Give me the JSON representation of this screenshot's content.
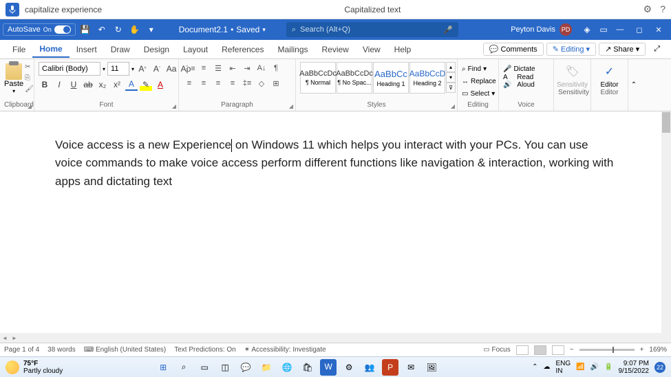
{
  "voice": {
    "status": "capitalize experience",
    "result": "Capitalized text",
    "settings_icon": "⚙",
    "help_icon": "?"
  },
  "titlebar": {
    "autosave_label": "AutoSave",
    "autosave_state": "On",
    "doc_name": "Document2.1",
    "doc_state": "Saved",
    "search_placeholder": "Search (Alt+Q)",
    "user_name": "Peyton Davis",
    "user_initials": "PD"
  },
  "tabs": [
    "File",
    "Home",
    "Insert",
    "Draw",
    "Design",
    "Layout",
    "References",
    "Mailings",
    "Review",
    "View",
    "Help"
  ],
  "active_tab": "Home",
  "tab_actions": {
    "comments": "Comments",
    "editing": "Editing",
    "share": "Share"
  },
  "ribbon": {
    "clipboard": {
      "label": "Clipboard",
      "paste": "Paste"
    },
    "font": {
      "label": "Font",
      "family": "Calibri (Body)",
      "size": "11",
      "buttons": {
        "bold": "B",
        "italic": "I",
        "underline": "U",
        "strike": "ab",
        "sub": "x₂",
        "sup": "x²",
        "effects": "A",
        "highlight": "✎",
        "color": "A"
      },
      "grow": "A",
      "shrink": "A",
      "case": "Aa",
      "clear": "Aρ"
    },
    "paragraph": {
      "label": "Paragraph"
    },
    "styles": {
      "label": "Styles",
      "items": [
        {
          "preview": "AaBbCcDc",
          "name": "¶ Normal"
        },
        {
          "preview": "AaBbCcDc",
          "name": "¶ No Spac..."
        },
        {
          "preview": "AaBbCc",
          "name": "Heading 1"
        },
        {
          "preview": "AaBbCcD",
          "name": "Heading 2"
        }
      ]
    },
    "editing": {
      "label": "Editing",
      "find": "Find",
      "replace": "Replace",
      "select": "Select"
    },
    "voice": {
      "label": "Voice",
      "dictate": "Dictate",
      "read": "Read Aloud"
    },
    "sensitivity": {
      "label": "Sensitivity",
      "btn": "Sensitivity"
    },
    "editor": {
      "label": "Editor",
      "btn": "Editor"
    }
  },
  "document": {
    "text_before": "Voice access is a new Experience",
    "text_after": " on Windows 11 which helps you interact with your PCs. You can use voice commands to make voice access perform different functions like navigation & interaction, working with apps and dictating text"
  },
  "statusbar": {
    "page": "Page 1 of 4",
    "words": "38 words",
    "lang": "English (United States)",
    "predictions": "Text Predictions: On",
    "accessibility": "Accessibility: Investigate",
    "focus": "Focus",
    "zoom": "169%"
  },
  "taskbar": {
    "temp": "75°F",
    "weather": "Partly cloudy",
    "lang": "ENG",
    "lang2": "IN",
    "time": "9:07 PM",
    "date": "9/15/2022",
    "notif": "22"
  }
}
